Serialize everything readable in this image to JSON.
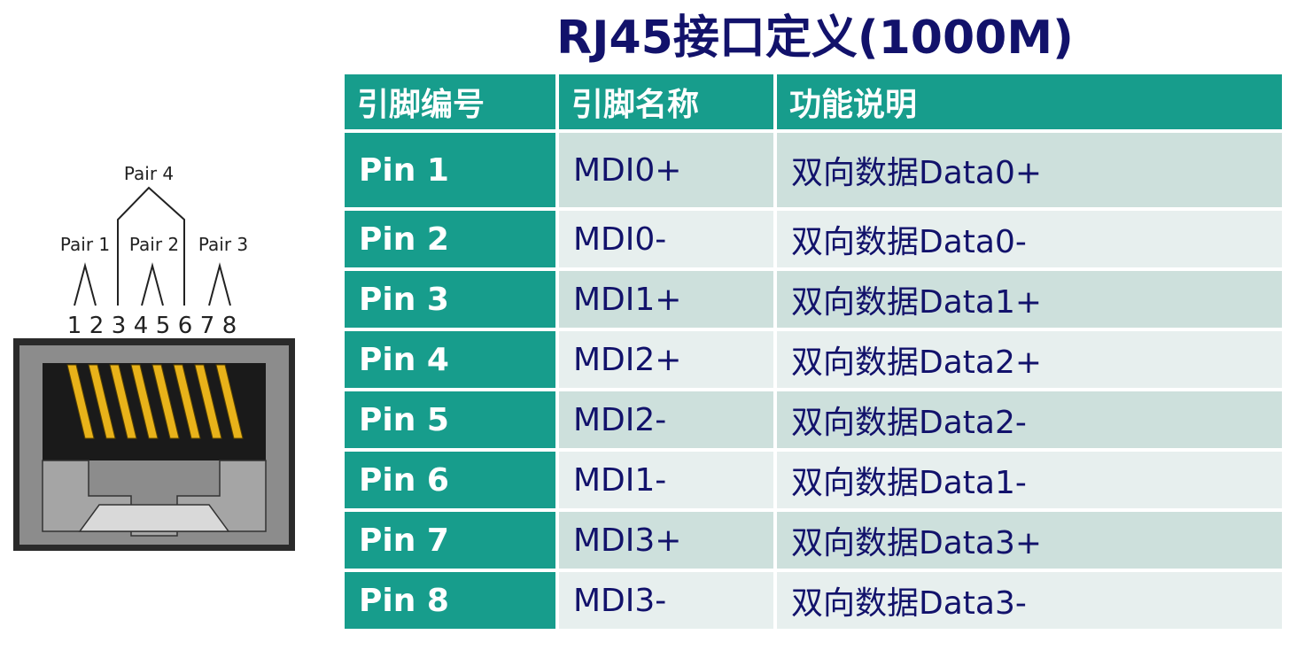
{
  "title": "RJ45接口定义(1000M)",
  "diagram": {
    "pair_labels": [
      "Pair 4",
      "Pair 1",
      "Pair 2",
      "Pair 3"
    ],
    "pin_numbers": [
      "1",
      "2",
      "3",
      "4",
      "5",
      "6",
      "7",
      "8"
    ]
  },
  "table": {
    "headers": [
      "引脚编号",
      "引脚名称",
      "功能说明"
    ],
    "rows": [
      {
        "pin": "Pin 1",
        "name": "MDI0+",
        "desc": "双向数据Data0+"
      },
      {
        "pin": "Pin 2",
        "name": "MDI0-",
        "desc": "双向数据Data0-"
      },
      {
        "pin": "Pin 3",
        "name": "MDI1+",
        "desc": "双向数据Data1+"
      },
      {
        "pin": "Pin 4",
        "name": "MDI2+",
        "desc": "双向数据Data2+"
      },
      {
        "pin": "Pin 5",
        "name": "MDI2-",
        "desc": "双向数据Data2-"
      },
      {
        "pin": "Pin 6",
        "name": "MDI1-",
        "desc": "双向数据Data1-"
      },
      {
        "pin": "Pin 7",
        "name": "MDI3+",
        "desc": "双向数据Data3+"
      },
      {
        "pin": "Pin 8",
        "name": "MDI3-",
        "desc": "双向数据Data3-"
      }
    ]
  },
  "colors": {
    "header_bg": "#179d8c",
    "title_color": "#12126b",
    "row_odd": "#cde0dc",
    "row_even": "#e7efee",
    "contact_yellow": "#e8b21a"
  }
}
